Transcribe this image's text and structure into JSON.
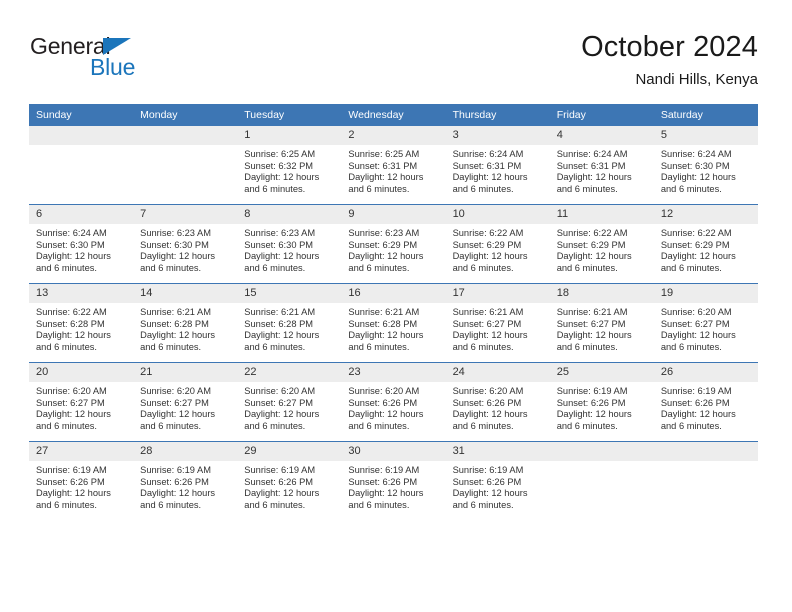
{
  "brand": {
    "name_part1": "General",
    "name_part2": "Blue",
    "triangle_color": "#1b75bb"
  },
  "header": {
    "title": "October 2024",
    "subtitle": "Nandi Hills, Kenya"
  },
  "colors": {
    "header_blue": "#3d76b4",
    "daynum_gray": "#ededed",
    "text": "#333333"
  },
  "weekday_headers": [
    "Sunday",
    "Monday",
    "Tuesday",
    "Wednesday",
    "Thursday",
    "Friday",
    "Saturday"
  ],
  "labels": {
    "sunrise_prefix": "Sunrise: ",
    "sunset_prefix": "Sunset: ",
    "daylight_prefix": "Daylight: "
  },
  "weeks": [
    [
      {
        "day": "",
        "blank": true
      },
      {
        "day": "",
        "blank": true
      },
      {
        "day": "1",
        "sunrise": "Sunrise: 6:25 AM",
        "sunset": "Sunset: 6:32 PM",
        "daylight_1": "Daylight: 12 hours",
        "daylight_2": "and 6 minutes."
      },
      {
        "day": "2",
        "sunrise": "Sunrise: 6:25 AM",
        "sunset": "Sunset: 6:31 PM",
        "daylight_1": "Daylight: 12 hours",
        "daylight_2": "and 6 minutes."
      },
      {
        "day": "3",
        "sunrise": "Sunrise: 6:24 AM",
        "sunset": "Sunset: 6:31 PM",
        "daylight_1": "Daylight: 12 hours",
        "daylight_2": "and 6 minutes."
      },
      {
        "day": "4",
        "sunrise": "Sunrise: 6:24 AM",
        "sunset": "Sunset: 6:31 PM",
        "daylight_1": "Daylight: 12 hours",
        "daylight_2": "and 6 minutes."
      },
      {
        "day": "5",
        "sunrise": "Sunrise: 6:24 AM",
        "sunset": "Sunset: 6:30 PM",
        "daylight_1": "Daylight: 12 hours",
        "daylight_2": "and 6 minutes."
      }
    ],
    [
      {
        "day": "6",
        "sunrise": "Sunrise: 6:24 AM",
        "sunset": "Sunset: 6:30 PM",
        "daylight_1": "Daylight: 12 hours",
        "daylight_2": "and 6 minutes."
      },
      {
        "day": "7",
        "sunrise": "Sunrise: 6:23 AM",
        "sunset": "Sunset: 6:30 PM",
        "daylight_1": "Daylight: 12 hours",
        "daylight_2": "and 6 minutes."
      },
      {
        "day": "8",
        "sunrise": "Sunrise: 6:23 AM",
        "sunset": "Sunset: 6:30 PM",
        "daylight_1": "Daylight: 12 hours",
        "daylight_2": "and 6 minutes."
      },
      {
        "day": "9",
        "sunrise": "Sunrise: 6:23 AM",
        "sunset": "Sunset: 6:29 PM",
        "daylight_1": "Daylight: 12 hours",
        "daylight_2": "and 6 minutes."
      },
      {
        "day": "10",
        "sunrise": "Sunrise: 6:22 AM",
        "sunset": "Sunset: 6:29 PM",
        "daylight_1": "Daylight: 12 hours",
        "daylight_2": "and 6 minutes."
      },
      {
        "day": "11",
        "sunrise": "Sunrise: 6:22 AM",
        "sunset": "Sunset: 6:29 PM",
        "daylight_1": "Daylight: 12 hours",
        "daylight_2": "and 6 minutes."
      },
      {
        "day": "12",
        "sunrise": "Sunrise: 6:22 AM",
        "sunset": "Sunset: 6:29 PM",
        "daylight_1": "Daylight: 12 hours",
        "daylight_2": "and 6 minutes."
      }
    ],
    [
      {
        "day": "13",
        "sunrise": "Sunrise: 6:22 AM",
        "sunset": "Sunset: 6:28 PM",
        "daylight_1": "Daylight: 12 hours",
        "daylight_2": "and 6 minutes."
      },
      {
        "day": "14",
        "sunrise": "Sunrise: 6:21 AM",
        "sunset": "Sunset: 6:28 PM",
        "daylight_1": "Daylight: 12 hours",
        "daylight_2": "and 6 minutes."
      },
      {
        "day": "15",
        "sunrise": "Sunrise: 6:21 AM",
        "sunset": "Sunset: 6:28 PM",
        "daylight_1": "Daylight: 12 hours",
        "daylight_2": "and 6 minutes."
      },
      {
        "day": "16",
        "sunrise": "Sunrise: 6:21 AM",
        "sunset": "Sunset: 6:28 PM",
        "daylight_1": "Daylight: 12 hours",
        "daylight_2": "and 6 minutes."
      },
      {
        "day": "17",
        "sunrise": "Sunrise: 6:21 AM",
        "sunset": "Sunset: 6:27 PM",
        "daylight_1": "Daylight: 12 hours",
        "daylight_2": "and 6 minutes."
      },
      {
        "day": "18",
        "sunrise": "Sunrise: 6:21 AM",
        "sunset": "Sunset: 6:27 PM",
        "daylight_1": "Daylight: 12 hours",
        "daylight_2": "and 6 minutes."
      },
      {
        "day": "19",
        "sunrise": "Sunrise: 6:20 AM",
        "sunset": "Sunset: 6:27 PM",
        "daylight_1": "Daylight: 12 hours",
        "daylight_2": "and 6 minutes."
      }
    ],
    [
      {
        "day": "20",
        "sunrise": "Sunrise: 6:20 AM",
        "sunset": "Sunset: 6:27 PM",
        "daylight_1": "Daylight: 12 hours",
        "daylight_2": "and 6 minutes."
      },
      {
        "day": "21",
        "sunrise": "Sunrise: 6:20 AM",
        "sunset": "Sunset: 6:27 PM",
        "daylight_1": "Daylight: 12 hours",
        "daylight_2": "and 6 minutes."
      },
      {
        "day": "22",
        "sunrise": "Sunrise: 6:20 AM",
        "sunset": "Sunset: 6:27 PM",
        "daylight_1": "Daylight: 12 hours",
        "daylight_2": "and 6 minutes."
      },
      {
        "day": "23",
        "sunrise": "Sunrise: 6:20 AM",
        "sunset": "Sunset: 6:26 PM",
        "daylight_1": "Daylight: 12 hours",
        "daylight_2": "and 6 minutes."
      },
      {
        "day": "24",
        "sunrise": "Sunrise: 6:20 AM",
        "sunset": "Sunset: 6:26 PM",
        "daylight_1": "Daylight: 12 hours",
        "daylight_2": "and 6 minutes."
      },
      {
        "day": "25",
        "sunrise": "Sunrise: 6:19 AM",
        "sunset": "Sunset: 6:26 PM",
        "daylight_1": "Daylight: 12 hours",
        "daylight_2": "and 6 minutes."
      },
      {
        "day": "26",
        "sunrise": "Sunrise: 6:19 AM",
        "sunset": "Sunset: 6:26 PM",
        "daylight_1": "Daylight: 12 hours",
        "daylight_2": "and 6 minutes."
      }
    ],
    [
      {
        "day": "27",
        "sunrise": "Sunrise: 6:19 AM",
        "sunset": "Sunset: 6:26 PM",
        "daylight_1": "Daylight: 12 hours",
        "daylight_2": "and 6 minutes."
      },
      {
        "day": "28",
        "sunrise": "Sunrise: 6:19 AM",
        "sunset": "Sunset: 6:26 PM",
        "daylight_1": "Daylight: 12 hours",
        "daylight_2": "and 6 minutes."
      },
      {
        "day": "29",
        "sunrise": "Sunrise: 6:19 AM",
        "sunset": "Sunset: 6:26 PM",
        "daylight_1": "Daylight: 12 hours",
        "daylight_2": "and 6 minutes."
      },
      {
        "day": "30",
        "sunrise": "Sunrise: 6:19 AM",
        "sunset": "Sunset: 6:26 PM",
        "daylight_1": "Daylight: 12 hours",
        "daylight_2": "and 6 minutes."
      },
      {
        "day": "31",
        "sunrise": "Sunrise: 6:19 AM",
        "sunset": "Sunset: 6:26 PM",
        "daylight_1": "Daylight: 12 hours",
        "daylight_2": "and 6 minutes."
      },
      {
        "day": "",
        "blank": true
      },
      {
        "day": "",
        "blank": true
      }
    ]
  ]
}
